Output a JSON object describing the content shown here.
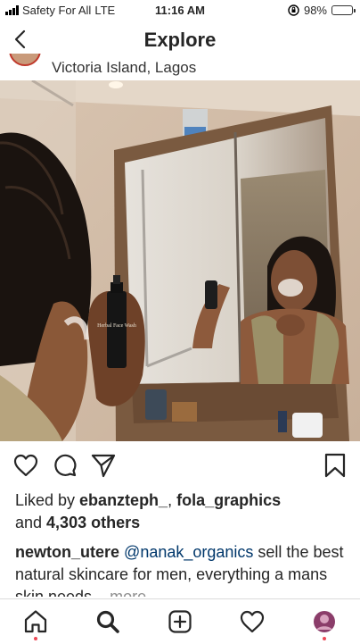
{
  "status_bar": {
    "carrier": "Safety For All",
    "network": "LTE",
    "time": "11:16 AM",
    "battery_percent": "98%",
    "battery_level": 0.98
  },
  "nav": {
    "title": "Explore",
    "back_icon": "chevron-left-icon"
  },
  "post": {
    "location": "Victoria Island, Lagos",
    "likes": {
      "prefix": "Liked by ",
      "user1": "ebanzteph_",
      "sep": ", ",
      "user2": "fola_graphics",
      "and": "and ",
      "count": "4,303 others"
    },
    "caption": {
      "username": "newton_utere",
      "mention": "@nanak_organics",
      "text": " sell the best natural skincare for men, everything a mans skin needs...",
      "more": "more"
    },
    "bottle_label": "Herbal Face Wash"
  },
  "actions": [
    "heart-icon",
    "comment-icon",
    "share-icon",
    "bookmark-icon"
  ],
  "tabs": [
    "home-icon",
    "search-icon",
    "add-post-icon",
    "activity-icon",
    "profile-icon"
  ],
  "colors": {
    "link": "#00376b",
    "muted": "#8e8e8e",
    "notification": "#ed4956",
    "battery": "#f5c518"
  }
}
